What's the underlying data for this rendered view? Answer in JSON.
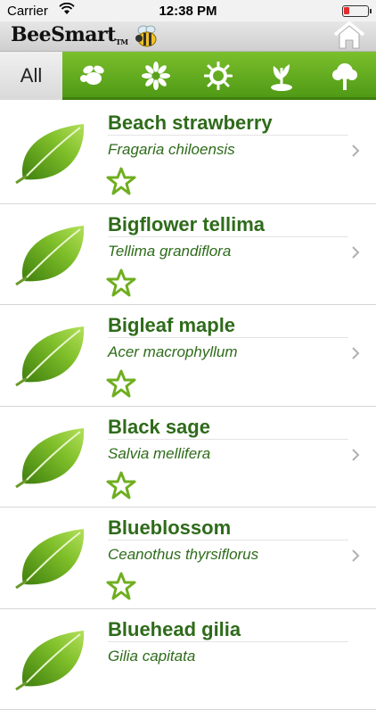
{
  "status": {
    "carrier": "Carrier",
    "time": "12:38 PM"
  },
  "app": {
    "brand": "BeeSmart",
    "tm": "TM"
  },
  "tabs": [
    {
      "label": "All",
      "selected": true
    },
    {
      "icon": "bee-icon"
    },
    {
      "icon": "flower-icon"
    },
    {
      "icon": "sun-icon"
    },
    {
      "icon": "seedling-icon"
    },
    {
      "icon": "tree-icon"
    }
  ],
  "plants": [
    {
      "name": "Beach strawberry",
      "scientific": "Fragaria chiloensis"
    },
    {
      "name": "Bigflower tellima",
      "scientific": "Tellima grandiflora"
    },
    {
      "name": "Bigleaf maple",
      "scientific": "Acer macrophyllum"
    },
    {
      "name": "Black sage",
      "scientific": "Salvia mellifera"
    },
    {
      "name": "Blueblossom",
      "scientific": "Ceanothus thyrsiflorus"
    },
    {
      "name": "Bluehead gilia",
      "scientific": "Gilia capitata"
    }
  ],
  "colors": {
    "accent_green": "#5aa21c",
    "text_green": "#2e6b1a"
  }
}
